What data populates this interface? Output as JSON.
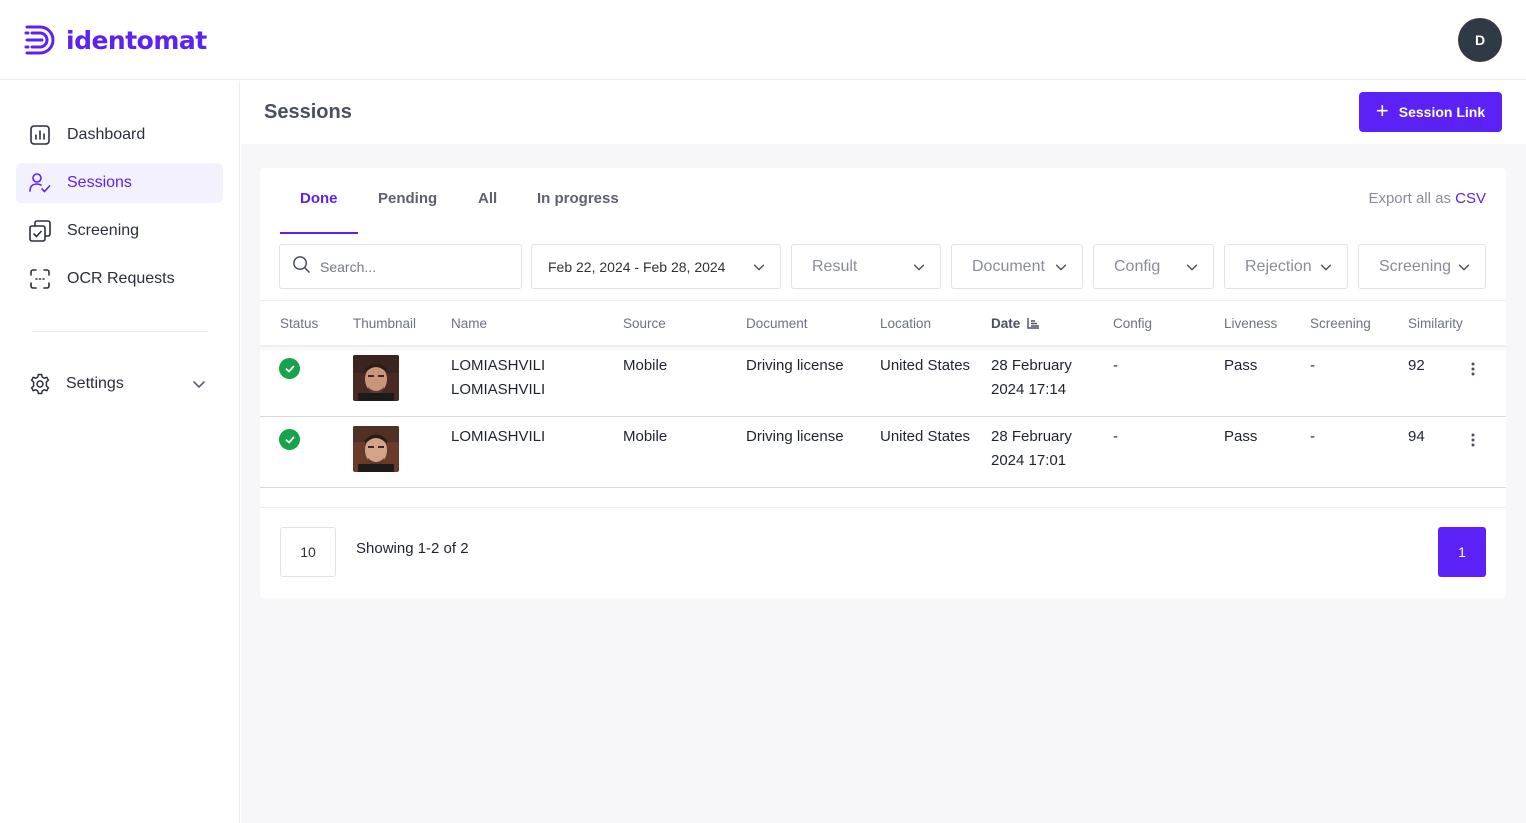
{
  "brand": {
    "name": "identomat",
    "color": "#5b21f5"
  },
  "user": {
    "initial": "D"
  },
  "sidebar": {
    "items": [
      {
        "label": "Dashboard",
        "icon": "chart-icon"
      },
      {
        "label": "Sessions",
        "icon": "users-icon",
        "active": true
      },
      {
        "label": "Screening",
        "icon": "screening-icon"
      },
      {
        "label": "OCR Requests",
        "icon": "scan-icon"
      }
    ],
    "settings": {
      "label": "Settings",
      "icon": "gear-icon"
    }
  },
  "page": {
    "title": "Sessions",
    "session_link_label": "Session Link"
  },
  "tabs": [
    {
      "label": "Done",
      "active": true
    },
    {
      "label": "Pending"
    },
    {
      "label": "All"
    },
    {
      "label": "In progress"
    }
  ],
  "export": {
    "prefix": "Export all as ",
    "link": "CSV"
  },
  "filters": {
    "search_placeholder": "Search...",
    "date_range": "Feb 22, 2024 - Feb 28, 2024",
    "result": "Result",
    "document": "Document",
    "config": "Config",
    "rejection": "Rejection",
    "screening": "Screening"
  },
  "table": {
    "columns": [
      "Status",
      "Thumbnail",
      "Name",
      "Source",
      "Document",
      "Location",
      "Date",
      "Config",
      "Liveness",
      "Screening",
      "Similarity"
    ],
    "rows": [
      {
        "status": "done",
        "name_line1": "LOMIASHVILI",
        "name_line2": "LOMIASHVILI",
        "source": "Mobile",
        "document": "Driving license",
        "location": "United States",
        "date_line1": "28 February",
        "date_line2": "2024 17:14",
        "config": "-",
        "liveness": "Pass",
        "screening": "-",
        "similarity": "92"
      },
      {
        "status": "done",
        "name_line1": "LOMIASHVILI",
        "name_line2": "",
        "source": "Mobile",
        "document": "Driving license",
        "location": "United States",
        "date_line1": "28 February",
        "date_line2": "2024 17:01",
        "config": "-",
        "liveness": "Pass",
        "screening": "-",
        "similarity": "94"
      }
    ]
  },
  "pagination": {
    "page_size": "10",
    "showing": "Showing 1-2 of 2",
    "current_page": "1"
  }
}
